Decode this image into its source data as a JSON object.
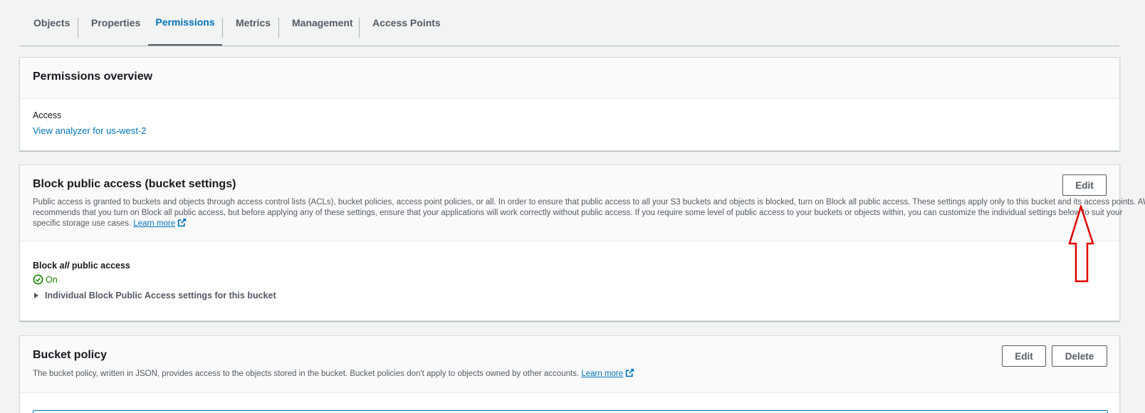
{
  "tabs": [
    {
      "label": "Objects"
    },
    {
      "label": "Properties"
    },
    {
      "label": "Permissions"
    },
    {
      "label": "Metrics"
    },
    {
      "label": "Management"
    },
    {
      "label": "Access Points"
    }
  ],
  "permissions_overview": {
    "title": "Permissions overview",
    "access_label": "Access",
    "analyzer_link": "View analyzer for us-west-2"
  },
  "block_public_access": {
    "title": "Block public access (bucket settings)",
    "edit_label": "Edit",
    "description_line1": "Public access is granted to buckets and objects through access control lists (ACLs), bucket policies, access point policies, or all. In order to ensure that public access to all your S3 buckets and objects is blocked, turn on Block all public access. These settings apply only to this bucket and its access points. AWS",
    "description_line2": "recommends that you turn on Block all public access, but before applying any of these settings, ensure that your applications will work correctly without public access. If you require some level of public access to your buckets or objects within, you can customize the individual settings below to suit your",
    "description_line3": "specific storage use cases.",
    "learn_more": "Learn more",
    "block_all_prefix": "Block ",
    "block_all_em": "all",
    "block_all_suffix": " public access",
    "status": "On",
    "expander_label": "Individual Block Public Access settings for this bucket",
    "status_color": "#1d8102"
  },
  "bucket_policy": {
    "title": "Bucket policy",
    "edit_label": "Edit",
    "delete_label": "Delete",
    "description": "The bucket policy, written in JSON, provides access to the objects stored in the bucket. Bucket policies don't apply to objects owned by other accounts.",
    "learn_more": "Learn more"
  },
  "annotation": {
    "arrow_color": "#e00000",
    "icon": "up-arrow-annotation"
  },
  "colors": {
    "accent": "#0073bb",
    "text": "#16191f",
    "muted": "#545b64"
  }
}
